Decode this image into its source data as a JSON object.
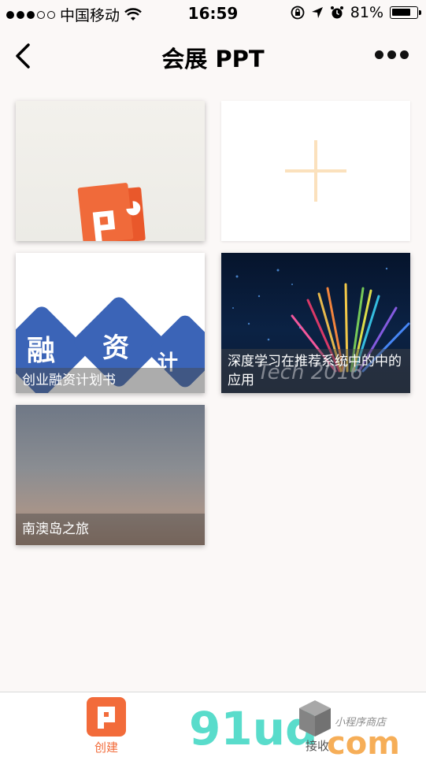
{
  "status_bar": {
    "carrier": "中国移动",
    "time": "16:59",
    "battery": "81%",
    "battery_level": 0.81,
    "signal_strength": 3,
    "signal_max": 5
  },
  "nav": {
    "title": "会展 PPT"
  },
  "cards": [
    {
      "label": "",
      "kind": "ppt-thumbnail"
    },
    {
      "label": "",
      "kind": "add"
    },
    {
      "label": "创业融资计划书",
      "kind": "deck",
      "cover_text": [
        "融",
        "资",
        "计"
      ]
    },
    {
      "label": "深度学习在推荐系统中的中的应用",
      "kind": "deck",
      "cover_text": "Tech 2016"
    },
    {
      "label": "南澳岛之旅",
      "kind": "deck"
    }
  ],
  "tabbar": {
    "create_label": "创建",
    "receive_label": "接收"
  },
  "watermark": {
    "brand": "91ud",
    "suffix": "com",
    "tagline": "小程序商店"
  },
  "colors": {
    "accent": "#f26b3a",
    "add_plus": "#fbe1bd",
    "watermark_green": "#3dd6c3",
    "watermark_orange": "#f5a03c"
  }
}
